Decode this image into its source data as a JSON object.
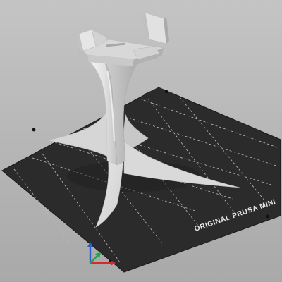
{
  "viewport": {
    "background_color": "#b8b8b8",
    "bed_color": "#2b2b2b",
    "grid_color": "#bdbdbd",
    "model_color": "#e3e3e3",
    "bed_label": "ORIGINAL PRUSA MINI",
    "axes_icon": "xyz-axes-icon",
    "axis_colors": {
      "x": "#d42a2a",
      "y": "#22a34a",
      "z": "#2d5ec7"
    }
  }
}
